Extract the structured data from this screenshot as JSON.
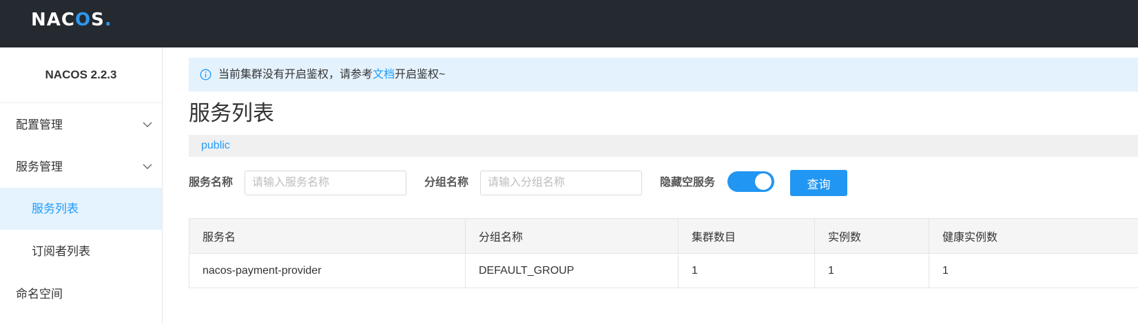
{
  "header": {
    "logo_main": "NAC",
    "logo_accent": "O",
    "logo_tail": "S",
    "logo_dot": "."
  },
  "sidebar": {
    "version": "NACOS 2.2.3",
    "items": [
      {
        "label": "配置管理",
        "expandable": true
      },
      {
        "label": "服务管理",
        "expandable": true
      },
      {
        "label": "服务列表",
        "active": true,
        "sub": true
      },
      {
        "label": "订阅者列表",
        "sub": true
      },
      {
        "label": "命名空间"
      }
    ]
  },
  "notice": {
    "prefix": "当前集群没有开启鉴权，请参考",
    "link": "文档",
    "suffix": "开启鉴权~"
  },
  "page": {
    "title": "服务列表",
    "namespace": "public"
  },
  "filters": {
    "service_name_label": "服务名称",
    "service_name_placeholder": "请输入服务名称",
    "service_name_value": "",
    "group_name_label": "分组名称",
    "group_name_placeholder": "请输入分组名称",
    "group_name_value": "",
    "hide_empty_label": "隐藏空服务",
    "hide_empty_on": true,
    "query_label": "查询"
  },
  "table": {
    "columns": [
      "服务名",
      "分组名称",
      "集群数目",
      "实例数",
      "健康实例数"
    ],
    "rows": [
      [
        "nacos-payment-provider",
        "DEFAULT_GROUP",
        "1",
        "1",
        "1"
      ]
    ]
  },
  "colors": {
    "topbar": "#252a31",
    "accent": "#209bfa",
    "primary_button": "#2196f3",
    "notice_bg": "#e3f2fd"
  }
}
